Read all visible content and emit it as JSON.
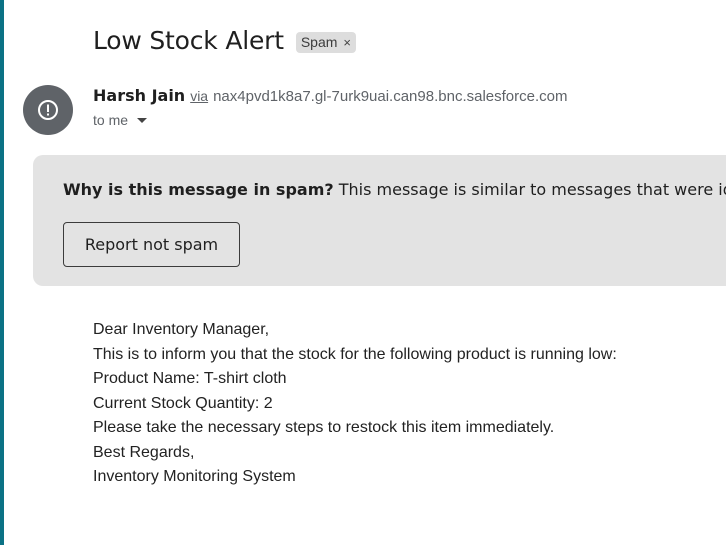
{
  "message": {
    "subject": "Low Stock Alert",
    "label_chip": "Spam",
    "label_remove_glyph": "×"
  },
  "sender": {
    "avatar_icon": "alert-circle-icon",
    "name": "Harsh Jain",
    "via": "via",
    "address": "nax4pvd1k8a7.gl-7urk9uai.can98.bnc.salesforce.com",
    "to": "to me"
  },
  "spam_notice": {
    "question": "Why is this message in spam?",
    "explanation": "This message is similar to messages that were identi",
    "report_button": "Report not spam"
  },
  "body": {
    "lines": [
      "Dear Inventory Manager,",
      "This is to inform you that the stock for the following product is running low:",
      "Product Name: T-shirt cloth",
      "Current Stock Quantity: 2",
      "Please take the necessary steps to restock this item immediately.",
      "Best Regards,",
      "Inventory Monitoring System"
    ]
  },
  "colors": {
    "banner_bg": "#e3e3e3",
    "avatar_bg": "#5f6368",
    "chip_bg": "#dddddd",
    "edge_accent": "#0b7285"
  }
}
